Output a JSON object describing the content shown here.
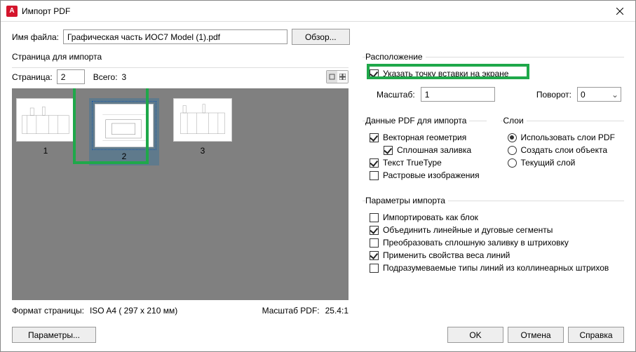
{
  "title": "Импорт PDF",
  "filename_label": "Имя файла:",
  "filename_value": "Графическая часть ИОС7 Model (1).pdf",
  "browse_label": "Обзор...",
  "page_for_import": "Страница для импорта",
  "page_label": "Страница:",
  "page_value": "2",
  "total_label": "Всего:",
  "total_value": "3",
  "thumb_labels": [
    "1",
    "2",
    "3"
  ],
  "page_format_label": "Формат страницы:",
  "page_format_value": "ISO A4 ( 297 x  210 мм)",
  "scale_pdf_label": "Масштаб PDF:",
  "scale_pdf_value": "25.4:1",
  "location": {
    "legend": "Расположение",
    "specify_label": "Указать точку вставки на экране",
    "scale_label": "Масштаб:",
    "scale_value": "1",
    "rotation_label": "Поворот:",
    "rotation_value": "0"
  },
  "pdf_data": {
    "legend": "Данные PDF для импорта",
    "vector": "Векторная геометрия",
    "solid": "Сплошная заливка",
    "truetype": "Текст TrueType",
    "raster": "Растровые изображения"
  },
  "layers": {
    "legend": "Слои",
    "use_pdf": "Использовать слои PDF",
    "create_obj": "Создать слои объекта",
    "current": "Текущий слой"
  },
  "import_params": {
    "legend": "Параметры импорта",
    "as_block": "Импортировать как блок",
    "join": "Объединить линейные и дуговые сегменты",
    "convert_solid": "Преобразовать сплошную заливку в штриховку",
    "apply_weight": "Применить свойства веса линий",
    "infer_linetypes": "Подразумеваемые типы линий из коллинеарных штрихов"
  },
  "params_btn": "Параметры...",
  "ok_btn": "OK",
  "cancel_btn": "Отмена",
  "help_btn": "Справка"
}
